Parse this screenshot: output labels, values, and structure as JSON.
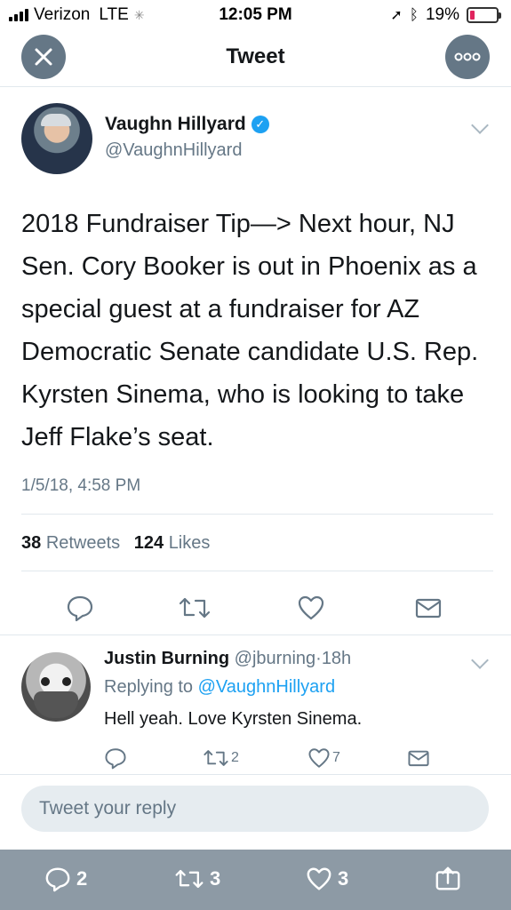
{
  "status_bar": {
    "carrier": "Verizon",
    "network": "LTE",
    "time": "12:05 PM",
    "battery": "19%",
    "battery_level": 0.19
  },
  "header": {
    "title": "Tweet"
  },
  "tweet": {
    "author_name": "Vaughn Hillyard",
    "author_handle": "@VaughnHillyard",
    "text": "2018 Fundraiser Tip—> Next hour, NJ Sen. Cory Booker is out in Phoenix as a special guest at a fundraiser for AZ Democratic Senate candidate U.S. Rep. Kyrsten Sinema, who is looking to take Jeff Flake’s seat.",
    "timestamp": "1/5/18, 4:58 PM",
    "retweets_count": "38",
    "retweets_label": "Retweets",
    "likes_count": "124",
    "likes_label": "Likes"
  },
  "reply": {
    "author_name": "Justin Burning",
    "author_handle": "@jburning",
    "separator": "·",
    "time": "18h",
    "replying_label": "Replying to",
    "replying_to": "@VaughnHillyard",
    "text": "Hell yeah. Love Kyrsten Sinema.",
    "reply_count": "",
    "retweet_count": "2",
    "like_count": "7"
  },
  "compose": {
    "placeholder": "Tweet your reply"
  },
  "bottom_bar": {
    "reply_count": "2",
    "retweet_count": "3",
    "like_count": "3"
  },
  "colors": {
    "accent": "#1da1f2",
    "secondary_text": "#657786",
    "bottom_bar": "#8d9aa5"
  }
}
